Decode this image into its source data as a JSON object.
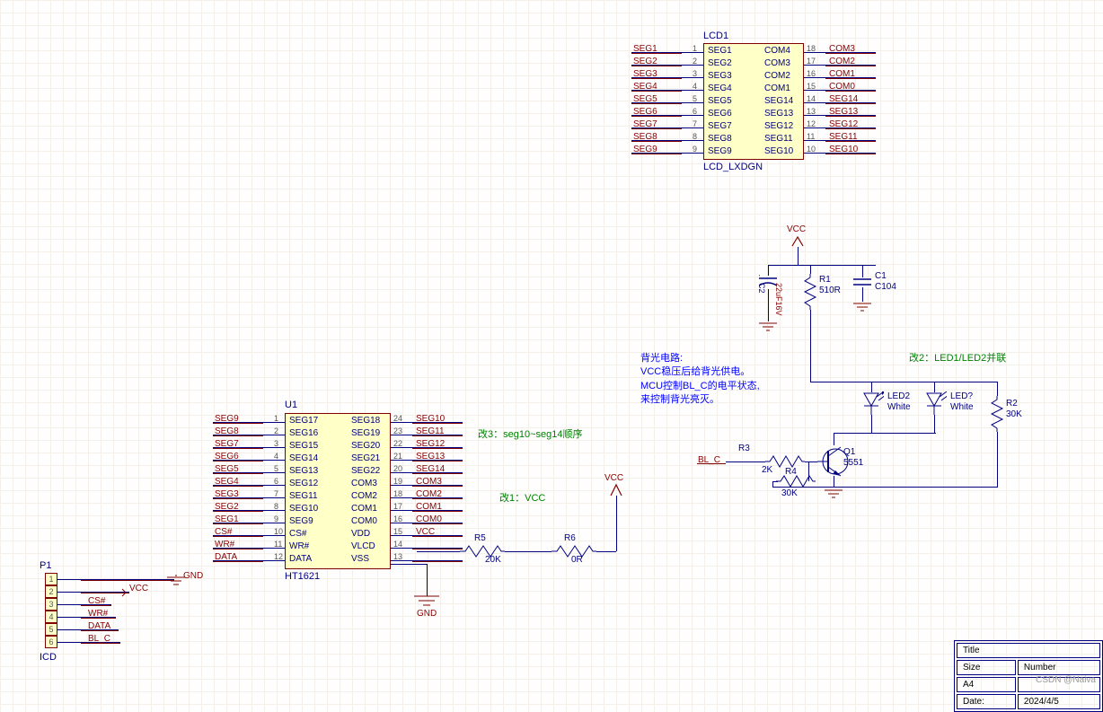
{
  "lcd1": {
    "designator": "LCD1",
    "part": "LCD_LXDGN",
    "left_pins": [
      {
        "num": "1",
        "net": "SEG1",
        "name": "SEG1"
      },
      {
        "num": "2",
        "net": "SEG2",
        "name": "SEG2"
      },
      {
        "num": "3",
        "net": "SEG3",
        "name": "SEG3"
      },
      {
        "num": "4",
        "net": "SEG4",
        "name": "SEG4"
      },
      {
        "num": "5",
        "net": "SEG5",
        "name": "SEG5"
      },
      {
        "num": "6",
        "net": "SEG6",
        "name": "SEG6"
      },
      {
        "num": "7",
        "net": "SEG7",
        "name": "SEG7"
      },
      {
        "num": "8",
        "net": "SEG8",
        "name": "SEG8"
      },
      {
        "num": "9",
        "net": "SEG9",
        "name": "SEG9"
      }
    ],
    "right_pins": [
      {
        "num": "18",
        "net": "COM3",
        "name": "COM4"
      },
      {
        "num": "17",
        "net": "COM2",
        "name": "COM3"
      },
      {
        "num": "16",
        "net": "COM1",
        "name": "COM2"
      },
      {
        "num": "15",
        "net": "COM0",
        "name": "COM1"
      },
      {
        "num": "14",
        "net": "SEG14",
        "name": "SEG14"
      },
      {
        "num": "13",
        "net": "SEG13",
        "name": "SEG13"
      },
      {
        "num": "12",
        "net": "SEG12",
        "name": "SEG12"
      },
      {
        "num": "11",
        "net": "SEG11",
        "name": "SEG11"
      },
      {
        "num": "10",
        "net": "SEG10",
        "name": "SEG10"
      }
    ]
  },
  "u1": {
    "designator": "U1",
    "part": "HT1621",
    "left_pins": [
      {
        "num": "1",
        "net": "SEG9",
        "name": "SEG17"
      },
      {
        "num": "2",
        "net": "SEG8",
        "name": "SEG16"
      },
      {
        "num": "3",
        "net": "SEG7",
        "name": "SEG15"
      },
      {
        "num": "4",
        "net": "SEG6",
        "name": "SEG14"
      },
      {
        "num": "5",
        "net": "SEG5",
        "name": "SEG13"
      },
      {
        "num": "6",
        "net": "SEG4",
        "name": "SEG12"
      },
      {
        "num": "7",
        "net": "SEG3",
        "name": "SEG11"
      },
      {
        "num": "8",
        "net": "SEG2",
        "name": "SEG10"
      },
      {
        "num": "9",
        "net": "SEG1",
        "name": "SEG9"
      },
      {
        "num": "10",
        "net": "CS#",
        "name": "CS#"
      },
      {
        "num": "11",
        "net": "WR#",
        "name": "WR#"
      },
      {
        "num": "12",
        "net": "DATA",
        "name": "DATA"
      }
    ],
    "right_pins": [
      {
        "num": "24",
        "net": "SEG10",
        "name": "SEG18"
      },
      {
        "num": "23",
        "net": "SEG11",
        "name": "SEG19"
      },
      {
        "num": "22",
        "net": "SEG12",
        "name": "SEG20"
      },
      {
        "num": "21",
        "net": "SEG13",
        "name": "SEG21"
      },
      {
        "num": "20",
        "net": "SEG14",
        "name": "SEG22"
      },
      {
        "num": "19",
        "net": "COM3",
        "name": "COM3"
      },
      {
        "num": "18",
        "net": "COM2",
        "name": "COM2"
      },
      {
        "num": "17",
        "net": "COM1",
        "name": "COM1"
      },
      {
        "num": "16",
        "net": "COM0",
        "name": "COM0"
      },
      {
        "num": "15",
        "net": "VCC",
        "name": "VDD"
      },
      {
        "num": "14",
        "net": "",
        "name": "VLCD"
      },
      {
        "num": "13",
        "net": "",
        "name": "VSS"
      }
    ]
  },
  "p1": {
    "designator": "P1",
    "part": "ICD",
    "pins": [
      "1",
      "2",
      "3",
      "4",
      "5",
      "6"
    ],
    "nets": [
      "GND",
      "VCC",
      "CS#",
      "WR#",
      "DATA",
      "BL_C"
    ]
  },
  "backlight": {
    "vcc": "VCC",
    "c2": {
      "ref": "C2",
      "val": "22uF16V"
    },
    "r1": {
      "ref": "R1",
      "val": "510R"
    },
    "c1": {
      "ref": "C1",
      "val": "C104"
    },
    "led2": {
      "ref": "LED2",
      "val": "White"
    },
    "led1": {
      "ref": "LED?",
      "val": "White"
    },
    "r2": {
      "ref": "R2",
      "val": "30K"
    },
    "r3": {
      "ref": "R3",
      "val": "2K"
    },
    "r4": {
      "ref": "R4",
      "val": "30K"
    },
    "q1": {
      "ref": "Q1",
      "val": "5551"
    },
    "bl_c": "BL_C"
  },
  "r5": {
    "ref": "R5",
    "val": "20K"
  },
  "r6": {
    "ref": "R6",
    "val": "0R"
  },
  "gnd1": "GND",
  "gnd2": "GND",
  "annotations": {
    "a1": "改3：seg10~seg14顺序",
    "a2": "改1：VCC",
    "a3": "改2：LED1/LED2并联",
    "bl_text": "背光电路:\nVCC稳压后给背光供电。\nMCU控制BL_C的电平状态,\n来控制背光亮灭。"
  },
  "titleblock": {
    "title_label": "Title",
    "size_label": "Size",
    "size": "A4",
    "number_label": "Number",
    "date_label": "Date:",
    "date": "2024/4/5"
  },
  "watermark": "CSDN @Naiva"
}
